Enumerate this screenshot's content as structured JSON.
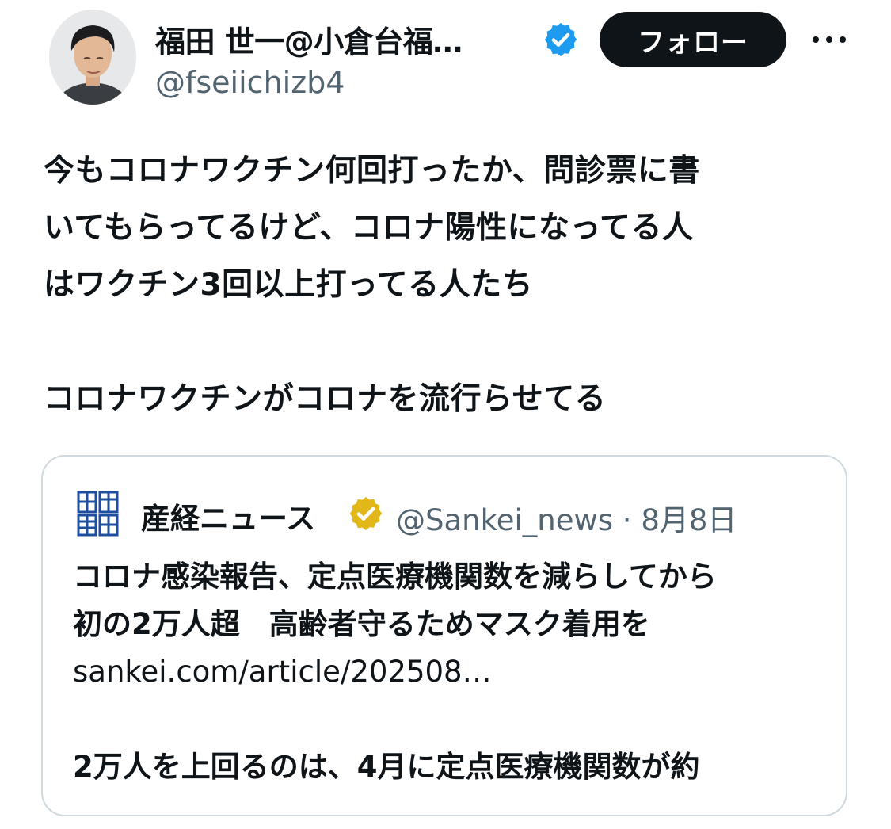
{
  "author": {
    "name": "福田 世一@小倉台福…",
    "handle": "@fseiichizb4",
    "verified_icon": "verified-badge-blue"
  },
  "follow_button": "フォロー",
  "more_icon": "more-horizontal-icon",
  "tweet": {
    "lines": [
      "今もコロナワクチン何回打ったか、問診票に書",
      "いてもらってるけど、コロナ陽性になってる人",
      "はワクチン3回以上打ってる人たち"
    ],
    "conclusion": "コロナワクチンがコロナを流行らせてる"
  },
  "quote": {
    "logo_text": "新聞産經",
    "name": "産経ニュース",
    "badge": "verified-badge-gold",
    "handle": "@Sankei_news",
    "separator": "·",
    "date": "8月8日",
    "lines": [
      "コロナ感染報告、定点医療機関数を減らしてから",
      "初の2万人超　高齢者守るためマスク着用を"
    ],
    "link": "sankei.com/article/202508…",
    "excerpt": "2万人を上回るのは、4月に定点医療機関数が約"
  },
  "colors": {
    "text": "#0f1419",
    "secondary": "#536471",
    "blue_badge": "#1d9bf0",
    "gold_badge": "#e2b719",
    "border": "#cfd9de",
    "sankei_logo": "#1f4e9e"
  }
}
